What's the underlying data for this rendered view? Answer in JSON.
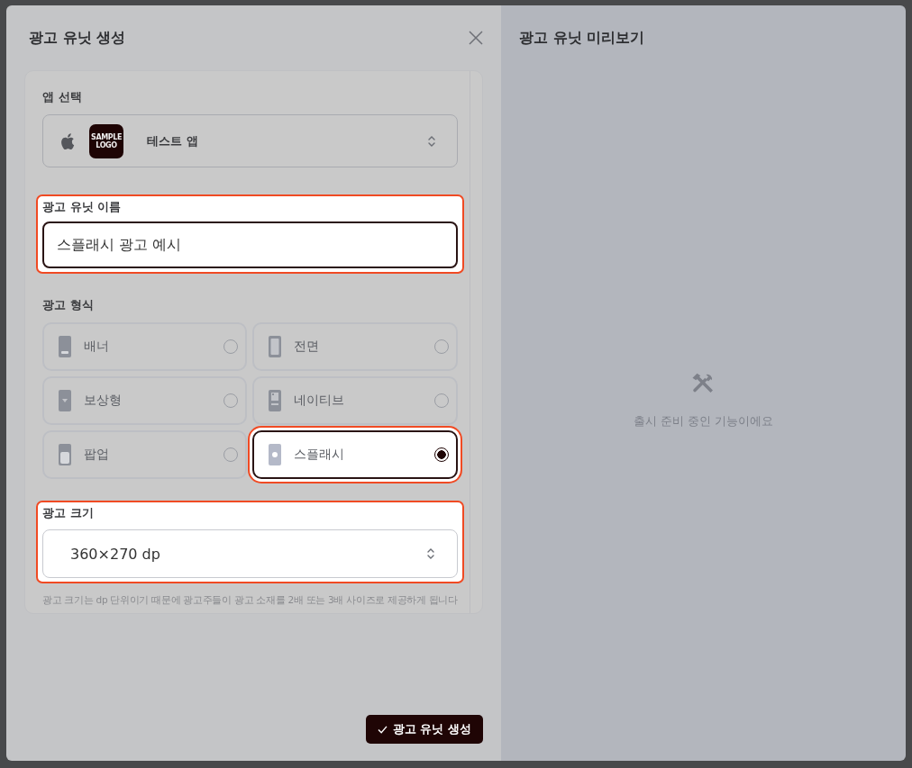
{
  "dialog": {
    "title": "광고 유닛 생성",
    "app_select": {
      "label": "앱 선택",
      "logo_text": "SAMPLE LOGO",
      "value": "테스트 앱"
    },
    "name_field": {
      "label": "광고 유닛 이름",
      "value": "스플래시 광고 예시",
      "highlighted": true,
      "focused": true
    },
    "ad_format": {
      "label": "광고 형식",
      "options": [
        {
          "label": "배너",
          "kind": "banner",
          "selected": false,
          "highlighted": false
        },
        {
          "label": "전면",
          "kind": "interstitial",
          "selected": false,
          "highlighted": false
        },
        {
          "label": "보상형",
          "kind": "rewarded",
          "selected": false,
          "highlighted": false
        },
        {
          "label": "네이티브",
          "kind": "native",
          "selected": false,
          "highlighted": false
        },
        {
          "label": "팝업",
          "kind": "popup",
          "selected": false,
          "highlighted": false
        },
        {
          "label": "스플래시",
          "kind": "splash",
          "selected": true,
          "highlighted": true
        }
      ]
    },
    "size_field": {
      "label": "광고 크기",
      "value": "360×270 dp",
      "highlighted": true,
      "help": "광고 크기는 dp 단위이기 때문에 광고주들이 광고 소재를 2배 또는 3배 사이즈로 제공하게 됩니다"
    },
    "submit_button": "광고 유닛 생성"
  },
  "preview": {
    "title": "광고 유닛 미리보기",
    "message": "출시 준비 중인 기능이에요"
  }
}
